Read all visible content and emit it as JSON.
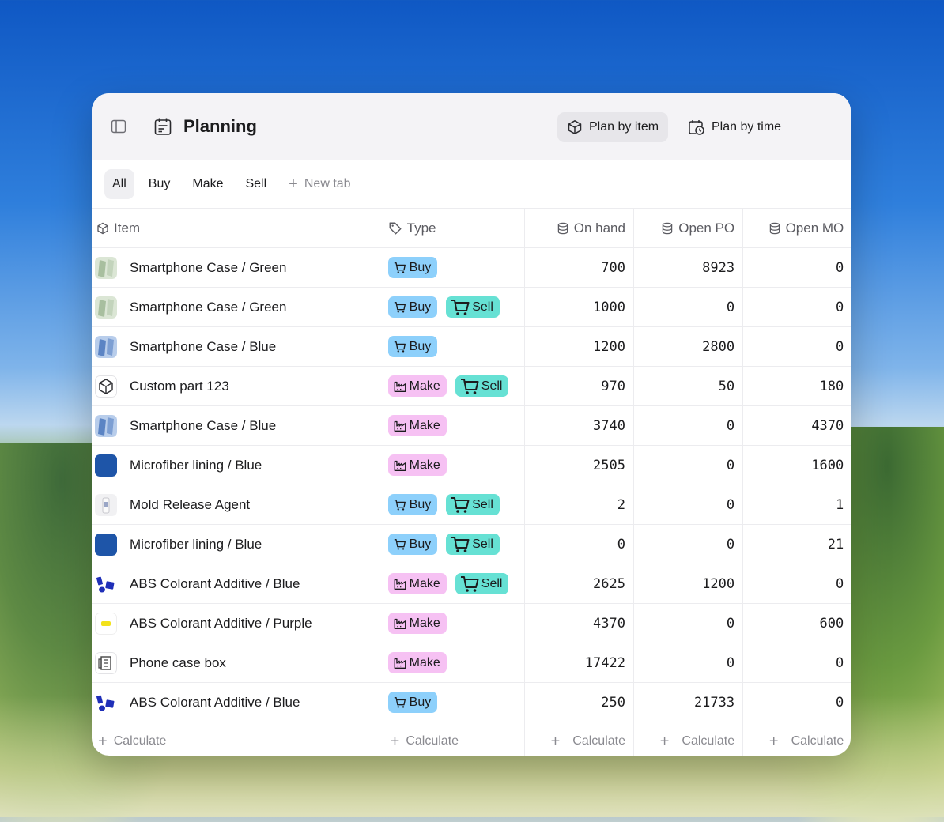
{
  "app": {
    "title": "Planning",
    "views": [
      "Plan by item",
      "Plan by time"
    ]
  },
  "tabs": [
    "All",
    "Buy",
    "Make",
    "Sell"
  ],
  "new_tab_label": "New tab",
  "columns": {
    "item": "Item",
    "type": "Type",
    "on_hand": "On hand",
    "open_po": "Open PO",
    "open_mo": "Open MO"
  },
  "rows": [
    {
      "name": "Smartphone Case / Green",
      "types": [
        "Buy"
      ],
      "on_hand": "700",
      "open_po": "8923",
      "open_mo": "0"
    },
    {
      "name": "Smartphone Case / Green",
      "types": [
        "Buy",
        "Sell"
      ],
      "on_hand": "1000",
      "open_po": "0",
      "open_mo": "0"
    },
    {
      "name": "Smartphone Case / Blue",
      "types": [
        "Buy"
      ],
      "on_hand": "1200",
      "open_po": "2800",
      "open_mo": "0"
    },
    {
      "name": "Custom part 123",
      "types": [
        "Make",
        "Sell"
      ],
      "on_hand": "970",
      "open_po": "50",
      "open_mo": "180"
    },
    {
      "name": "Smartphone Case / Blue",
      "types": [
        "Make"
      ],
      "on_hand": "3740",
      "open_po": "0",
      "open_mo": "4370"
    },
    {
      "name": "Microfiber lining / Blue",
      "types": [
        "Make"
      ],
      "on_hand": "2505",
      "open_po": "0",
      "open_mo": "1600"
    },
    {
      "name": "Mold Release Agent",
      "types": [
        "Buy",
        "Sell"
      ],
      "on_hand": "2",
      "open_po": "0",
      "open_mo": "1"
    },
    {
      "name": "Microfiber lining / Blue",
      "types": [
        "Buy",
        "Sell"
      ],
      "on_hand": "0",
      "open_po": "0",
      "open_mo": "21"
    },
    {
      "name": "ABS Colorant Additive / Blue",
      "types": [
        "Make",
        "Sell"
      ],
      "on_hand": "2625",
      "open_po": "1200",
      "open_mo": "0"
    },
    {
      "name": "ABS Colorant Additive / Purple",
      "types": [
        "Make"
      ],
      "on_hand": "4370",
      "open_po": "0",
      "open_mo": "600"
    },
    {
      "name": "Phone case box",
      "types": [
        "Make"
      ],
      "on_hand": "17422",
      "open_po": "0",
      "open_mo": "0"
    },
    {
      "name": "ABS Colorant Additive / Blue",
      "types": [
        "Buy"
      ],
      "on_hand": "250",
      "open_po": "21733",
      "open_mo": "0"
    }
  ],
  "calculate_label": "Calculate",
  "colors": {
    "buy": "#8dd0fb",
    "make": "#f6c1f3",
    "sell": "#66e1d4"
  }
}
